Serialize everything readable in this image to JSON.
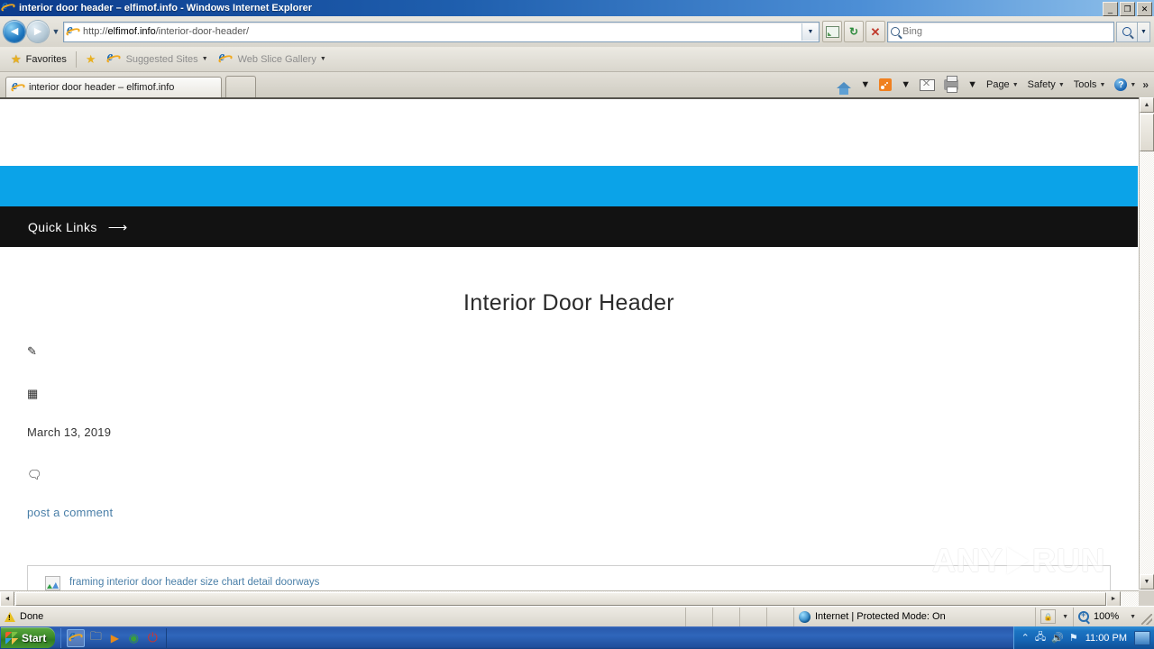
{
  "window": {
    "title": "interior door header – elfimof.info - Windows Internet Explorer",
    "minimize_label": "_",
    "restore_label": "❐",
    "close_label": "✕"
  },
  "navbar": {
    "back_label": "◄",
    "forward_label": "►",
    "recent_label": "▼",
    "url_scheme": "http://",
    "url_host": "elfimof.info",
    "url_path": "/interior-door-header/",
    "address_dropdown": "▼",
    "compatibility_label": "Compatibility View",
    "refresh_label": "↻",
    "stop_label": "✕",
    "search_placeholder": "Bing",
    "search_go_label": "Search",
    "search_dropdown": "▼"
  },
  "favorites_bar": {
    "favorites_label": "Favorites",
    "add_label": "Add to Favorites Bar",
    "items": [
      {
        "label": "Suggested Sites",
        "caret": "▼"
      },
      {
        "label": "Web Slice Gallery",
        "caret": "▼"
      }
    ]
  },
  "tabs": {
    "items": [
      {
        "label": "interior door header – elfimof.info",
        "active": true
      }
    ],
    "new_tab_label": ""
  },
  "command_bar": {
    "home_label": "Home",
    "feeds_label": "Feeds",
    "mail_label": "Read Mail",
    "print_label": "Print",
    "caret": "▼",
    "items": [
      {
        "label": "Page",
        "caret": "▼"
      },
      {
        "label": "Safety",
        "caret": "▼"
      },
      {
        "label": "Tools",
        "caret": "▼"
      }
    ],
    "help_label": "?",
    "overflow_label": "»"
  },
  "page": {
    "quick_links_label": "Quick Links",
    "quick_links_arrow": "⟶",
    "post_title": "Interior Door Header",
    "author_icon": "✎",
    "calendar_icon": "▦",
    "date": "March 13, 2019",
    "comment_icon": "🗨",
    "comment_link": "post a comment",
    "image_alt": "framing interior door header size chart detail doorways",
    "colors": {
      "accent_blue": "#0ba3e8",
      "nav_black": "#121212",
      "link_blue": "#4a7fa8"
    },
    "watermark": {
      "left": "ANY",
      "right": "RUN"
    }
  },
  "scrollbars": {
    "up_arrow": "▲",
    "down_arrow": "▼",
    "left_arrow": "◄",
    "right_arrow": "►"
  },
  "statusbar": {
    "status_text": "Done",
    "zone_text": "Internet | Protected Mode: On",
    "zone_caret": "▼",
    "zoom_level": "100%",
    "zoom_caret": "▼"
  },
  "taskbar": {
    "start_label": "Start",
    "quick_launch": [
      {
        "name": "internet-explorer",
        "glyph": "e"
      },
      {
        "name": "windows-explorer",
        "glyph": "📁"
      },
      {
        "name": "media-player",
        "glyph": "▶"
      },
      {
        "name": "google-chrome",
        "glyph": "◉"
      },
      {
        "name": "shutdown-app",
        "glyph": "⏻"
      }
    ],
    "tray": {
      "show_hidden": "⌃",
      "network": "🖧",
      "volume": "🔊",
      "flag": "⚑",
      "clock": "11:00 PM",
      "show_desktop": ""
    }
  }
}
